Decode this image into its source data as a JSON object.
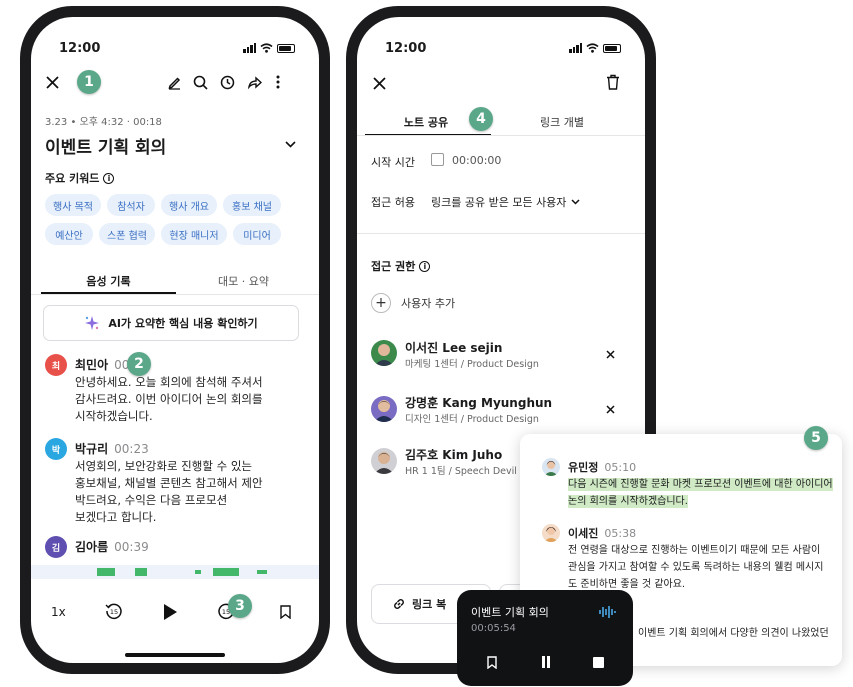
{
  "phone1": {
    "status_time": "12:00",
    "badge": "1",
    "meta": "3.23 • 오후 4:32 · 00:18",
    "title": "이벤트 기획 회의",
    "keywords_label": "주요 키워드",
    "keywords": [
      "행사 목적",
      "참석자",
      "행사 개요",
      "홍보 채널",
      "예산안",
      "스폰 협력",
      "현장 매니저",
      "미디어"
    ],
    "tabs": [
      "음성 기록",
      "대모 · 요약"
    ],
    "ai_button": "AI가 요약한 핵심 내용 확인하기",
    "transcript": [
      {
        "initial": "최",
        "name": "최민아",
        "time": "00",
        "color": "#e8514a",
        "text": [
          "안녕하세요. 오늘 회의에 참석해 주셔서",
          "감사드려요. 이번 아이디어 논의 회의를",
          "시작하겠습니다."
        ]
      },
      {
        "initial": "박",
        "name": "박규리",
        "time": "00:23",
        "color": "#2aa6e0",
        "text": [
          "서영회의, 보안강화로 진행할 수 있는",
          "홍보채널, 채널별 콘텐츠 참고해서 제안",
          "박드려요, 수익은 다음 프로모션",
          "보겠다고 합니다."
        ]
      },
      {
        "initial": "김",
        "name": "김아름",
        "time": "00:39",
        "color": "#5e4fb0",
        "text": []
      }
    ],
    "badge2": "2",
    "speed": "1x",
    "badge3": "3"
  },
  "phone2": {
    "status_time": "12:00",
    "tabs": [
      "노트 공유",
      "링크 개별"
    ],
    "badge4": "4",
    "start_time_label": "시작 시간",
    "start_time_value": "00:00:00",
    "access_label": "접근 허용",
    "access_value": "링크를 공유 받은 모든 사용자",
    "permission_label": "접근 권한",
    "add_user": "사용자 추가",
    "people": [
      {
        "name": "이서진  Lee sejin",
        "role": "마케팅 1센터 / Product Design"
      },
      {
        "name": "강명훈  Kang Myunghun",
        "role": "디자인 1센터 / Product Design"
      },
      {
        "name": "김주호  Kim Juho",
        "role": "HR 1 1팀 / Speech Devil"
      }
    ],
    "link_button": "링크 복"
  },
  "popup": {
    "badge5": "5",
    "comments": [
      {
        "name": "유민정",
        "time": "05:10",
        "lines": [
          "다음 시즌에 진행할 문화 마켓 프로모션 이벤트에 대한 아이디어",
          "논의 회의를 시작하겠습니다."
        ],
        "highlight": true
      },
      {
        "name": "이세진",
        "time": "05:38",
        "lines": [
          "전 연령을 대상으로 진행하는 이벤트이기 때문에 모든 사람이",
          "관심을 가지고 참여할 수 있도록 독려하는 내용의 웰컴 메시지",
          "도 준비하면 좋을 것 같아요."
        ],
        "highlight": false
      }
    ],
    "trailing": "이벤트 기획 회의에서 다양한 의견이 나왔었던"
  },
  "player": {
    "title": "이벤트 기획 회의",
    "elapsed": "00:05:54"
  }
}
